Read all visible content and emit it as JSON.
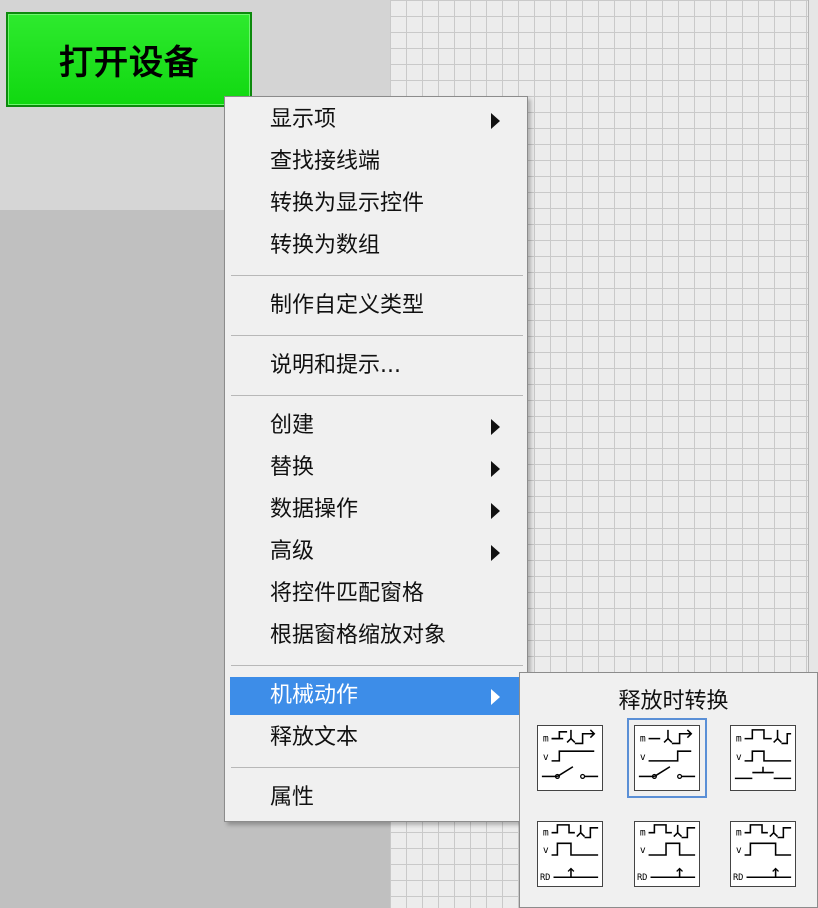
{
  "front_panel": {
    "button_label": "打开设备"
  },
  "context_menu": {
    "items": [
      {
        "label": "显示项",
        "submenu": true
      },
      {
        "label": "查找接线端",
        "submenu": false
      },
      {
        "label": "转换为显示控件",
        "submenu": false
      },
      {
        "label": "转换为数组",
        "submenu": false
      },
      {
        "label": "制作自定义类型",
        "submenu": false
      },
      {
        "label": "说明和提示...",
        "submenu": false
      },
      {
        "label": "创建",
        "submenu": true
      },
      {
        "label": "替换",
        "submenu": true
      },
      {
        "label": "数据操作",
        "submenu": true
      },
      {
        "label": "高级",
        "submenu": true
      },
      {
        "label": "将控件匹配窗格",
        "submenu": false
      },
      {
        "label": "根据窗格缩放对象",
        "submenu": false
      },
      {
        "label": "机械动作",
        "submenu": true,
        "selected": true
      },
      {
        "label": "释放文本",
        "submenu": false
      },
      {
        "label": "属性",
        "submenu": false
      }
    ]
  },
  "mechanical_action_palette": {
    "title": "释放时转换",
    "tiles": [
      {
        "icon": "switch-when-pressed-icon",
        "m_label": "m",
        "v_label": "v"
      },
      {
        "icon": "switch-when-released-icon",
        "m_label": "m",
        "v_label": "v",
        "selected": true
      },
      {
        "icon": "switch-until-released-icon",
        "m_label": "m",
        "v_label": "v"
      },
      {
        "icon": "latch-when-pressed-icon",
        "m_label": "m",
        "v_label": "v",
        "rd_label": "RD"
      },
      {
        "icon": "latch-when-released-icon",
        "m_label": "m",
        "v_label": "v",
        "rd_label": "RD"
      },
      {
        "icon": "latch-until-released-icon",
        "m_label": "m",
        "v_label": "v",
        "rd_label": "RD"
      }
    ]
  },
  "colors": {
    "button_green": "#1fe01f",
    "menu_highlight": "#3d8de8",
    "menu_bg": "#f0f0f0"
  }
}
